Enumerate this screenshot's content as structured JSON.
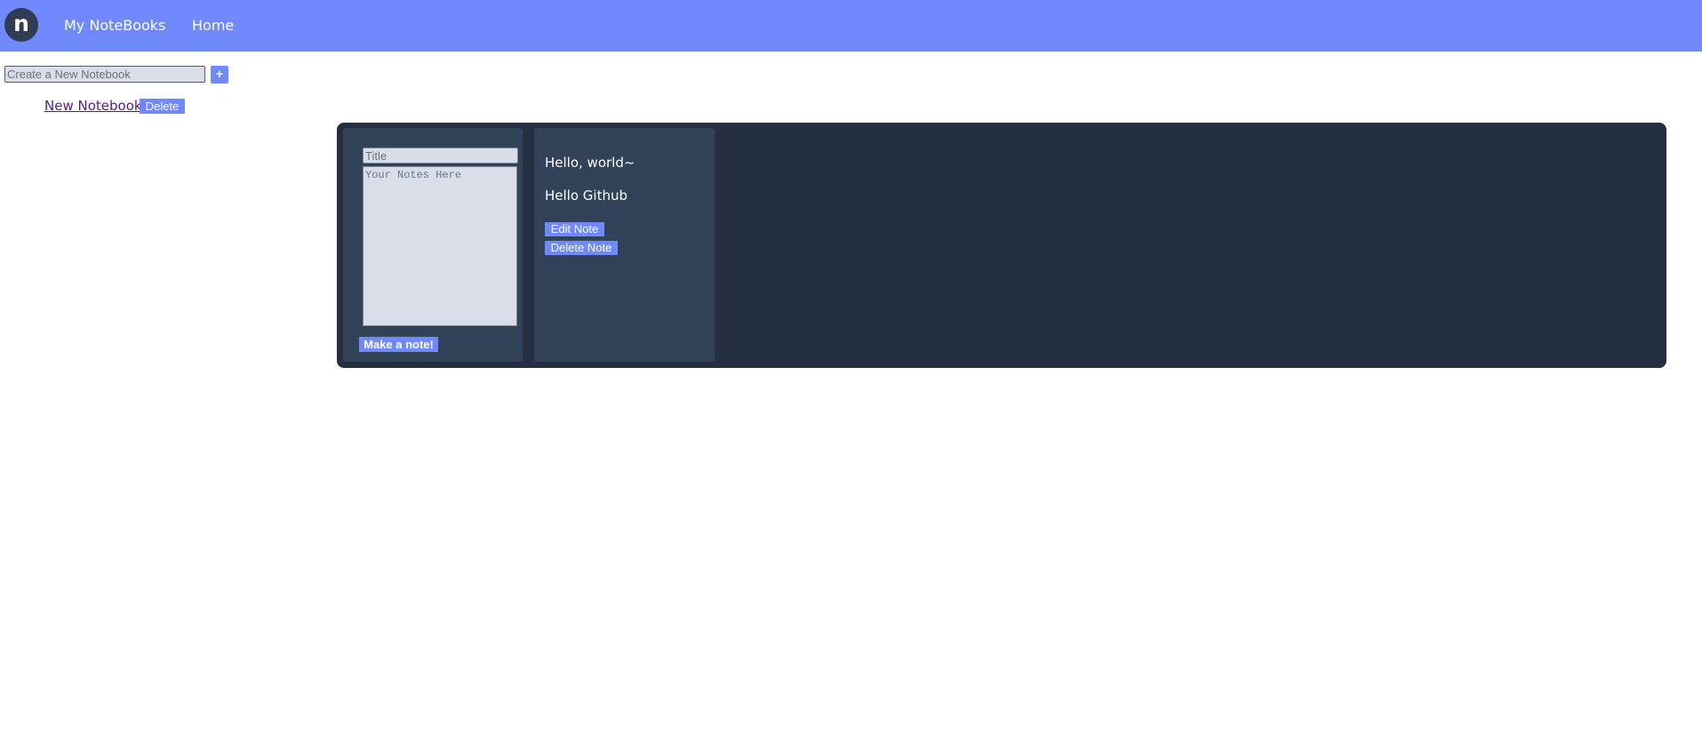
{
  "navbar": {
    "logo_letter": "n",
    "links": [
      {
        "label": "My NoteBooks"
      },
      {
        "label": "Home"
      }
    ]
  },
  "notebook_form": {
    "placeholder": "Create a New Notebook",
    "add_label": "+"
  },
  "notebooks": [
    {
      "name": "New Notebook",
      "delete_label": "Delete"
    }
  ],
  "note_form": {
    "title_placeholder": "Title",
    "body_placeholder": "Your Notes Here",
    "submit_label": "Make a note!"
  },
  "notes": [
    {
      "title": "Hello, world~",
      "body": "Hello Github",
      "edit_label": "Edit Note",
      "delete_label": "Delete Note"
    }
  ],
  "colors": {
    "navbar": "#7089ff",
    "accent_button": "#7089ff",
    "workspace": "#243042",
    "card": "#324258",
    "logo": "#2f3c52"
  }
}
